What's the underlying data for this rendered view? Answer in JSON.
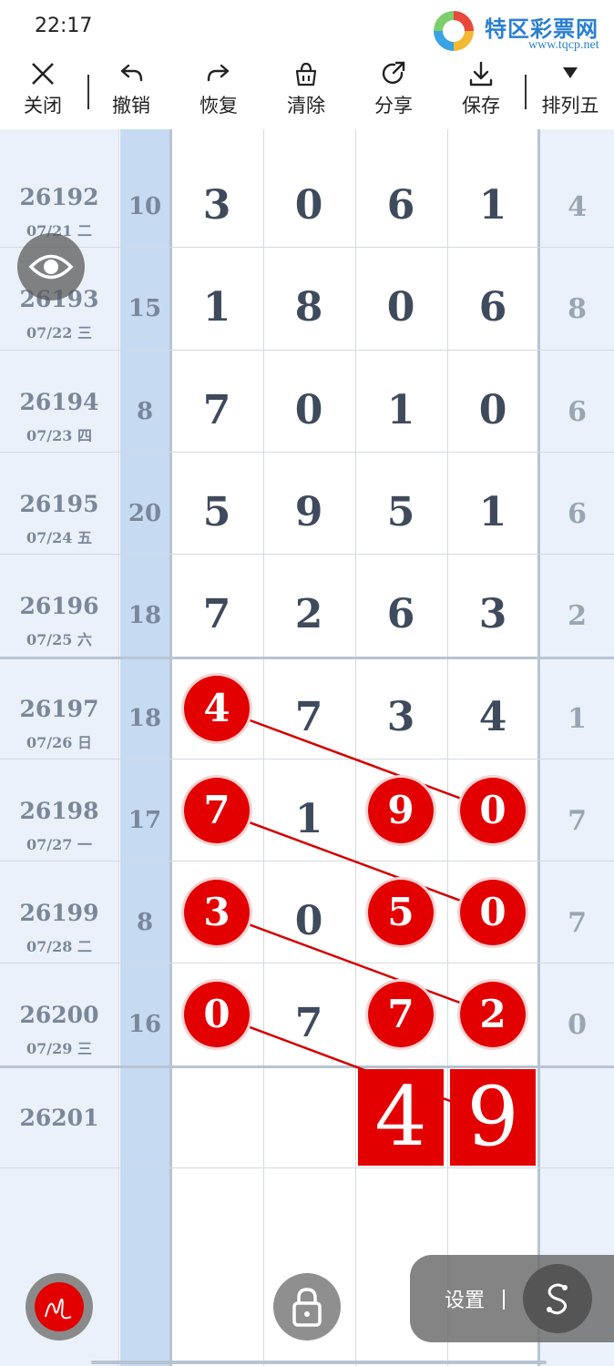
{
  "status": {
    "time": "22:17"
  },
  "watermark": {
    "title": "特区彩票网",
    "url": "www.tqcp.net"
  },
  "toolbar": {
    "close": "关闭",
    "undo": "撤销",
    "redo": "恢复",
    "clear": "清除",
    "share": "分享",
    "save": "保存",
    "mode": "排列五"
  },
  "rows": [
    {
      "issue": "26192",
      "date": "07/21 二",
      "sum": "10",
      "d": [
        "3",
        "0",
        "6",
        "1"
      ],
      "r": "4"
    },
    {
      "issue": "26193",
      "date": "07/22 三",
      "sum": "15",
      "d": [
        "1",
        "8",
        "0",
        "6"
      ],
      "r": "8"
    },
    {
      "issue": "26194",
      "date": "07/23 四",
      "sum": "8",
      "d": [
        "7",
        "0",
        "1",
        "0"
      ],
      "r": "6"
    },
    {
      "issue": "26195",
      "date": "07/24 五",
      "sum": "20",
      "d": [
        "5",
        "9",
        "5",
        "1"
      ],
      "r": "6"
    },
    {
      "issue": "26196",
      "date": "07/25 六",
      "sum": "18",
      "d": [
        "7",
        "2",
        "6",
        "3"
      ],
      "r": "2"
    },
    {
      "issue": "26197",
      "date": "07/26 日",
      "sum": "18",
      "d": [
        "4",
        "7",
        "3",
        "4"
      ],
      "r": "1"
    },
    {
      "issue": "26198",
      "date": "07/27 一",
      "sum": "17",
      "d": [
        "7",
        "1",
        "9",
        "0"
      ],
      "r": "7"
    },
    {
      "issue": "26199",
      "date": "07/28 二",
      "sum": "8",
      "d": [
        "3",
        "0",
        "5",
        "0"
      ],
      "r": "7"
    },
    {
      "issue": "26200",
      "date": "07/29 三",
      "sum": "16",
      "d": [
        "0",
        "7",
        "7",
        "2"
      ],
      "r": "0"
    },
    {
      "issue": "26201",
      "date": "",
      "sum": "",
      "d": [
        "",
        "",
        "",
        ""
      ],
      "r": ""
    }
  ],
  "prediction": [
    "4",
    "9"
  ],
  "settings": {
    "label": "设置"
  },
  "colors": {
    "accent": "#e30000",
    "sumColumn": "#c6daf2",
    "sideColumn": "#eaf1fa"
  },
  "icons": [
    "close-icon",
    "undo-icon",
    "redo-icon",
    "clear-icon",
    "share-icon",
    "save-icon",
    "dropdown-icon",
    "eye-icon",
    "pen-icon",
    "lock-icon",
    "settings-s-icon"
  ]
}
